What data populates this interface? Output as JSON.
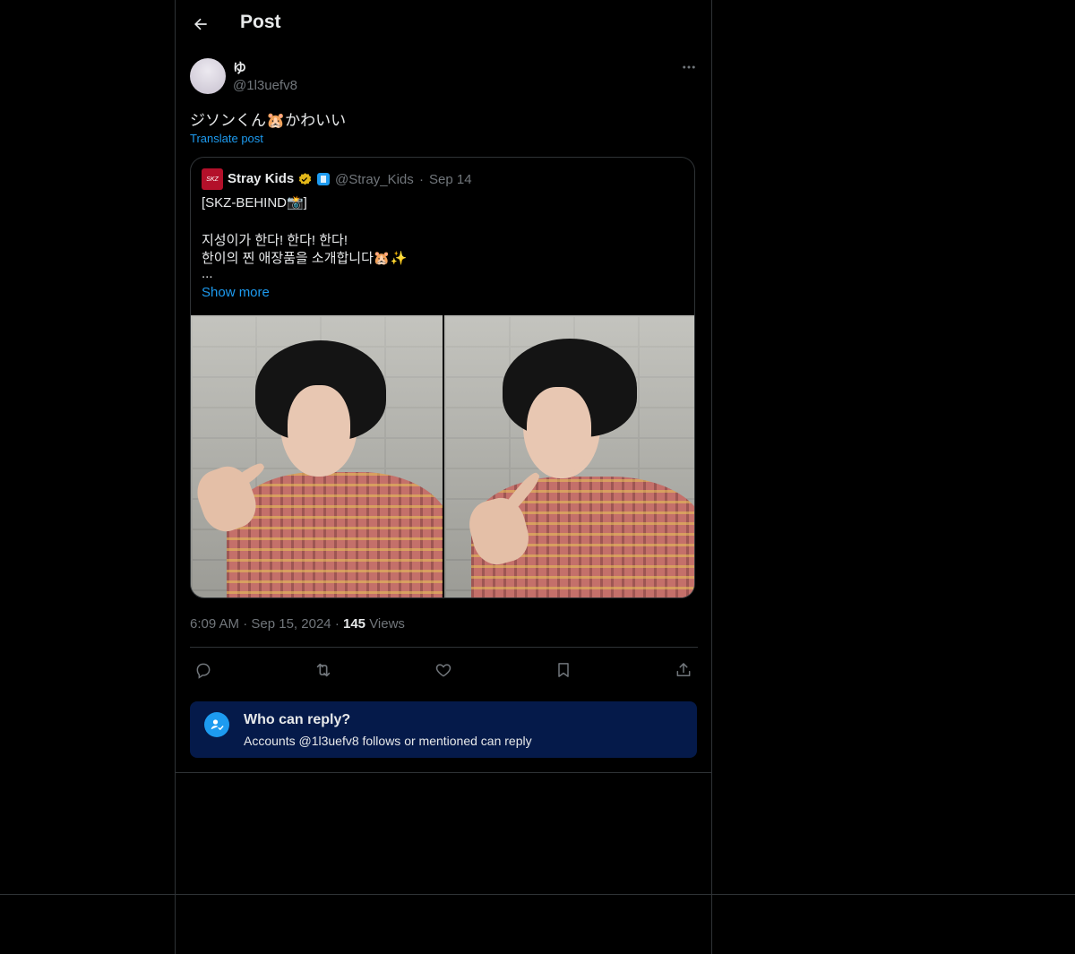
{
  "header": {
    "title": "Post"
  },
  "post": {
    "author_name": "ゆ",
    "author_handle": "@1l3uefv8",
    "text": "ジソンくん🐹かわいい",
    "translate_label": "Translate post",
    "time": "6:09 AM",
    "date": "Sep 15, 2024",
    "views_count": "145",
    "views_label": "Views"
  },
  "quote": {
    "name": "Stray Kids",
    "avatar_text": "SKZ",
    "handle": "@Stray_Kids",
    "date": "Sep 14",
    "line1": "[SKZ-BEHIND📸]",
    "line2": "지성이가 한다! 한다! 한다!",
    "line3": "한이의 찐 애장품을 소개합니다🐹✨",
    "line4": "...",
    "show_more": "Show more"
  },
  "actions": [
    "reply-icon",
    "repost-icon",
    "like-icon",
    "bookmark-icon",
    "share-icon"
  ],
  "reply_settings": {
    "title": "Who can reply?",
    "subtitle": "Accounts @1l3uefv8 follows or mentioned can reply"
  },
  "colors": {
    "background": "#000000",
    "accent": "#1d9bf0",
    "muted_text": "#71767b",
    "reply_box": "#051a4a"
  }
}
